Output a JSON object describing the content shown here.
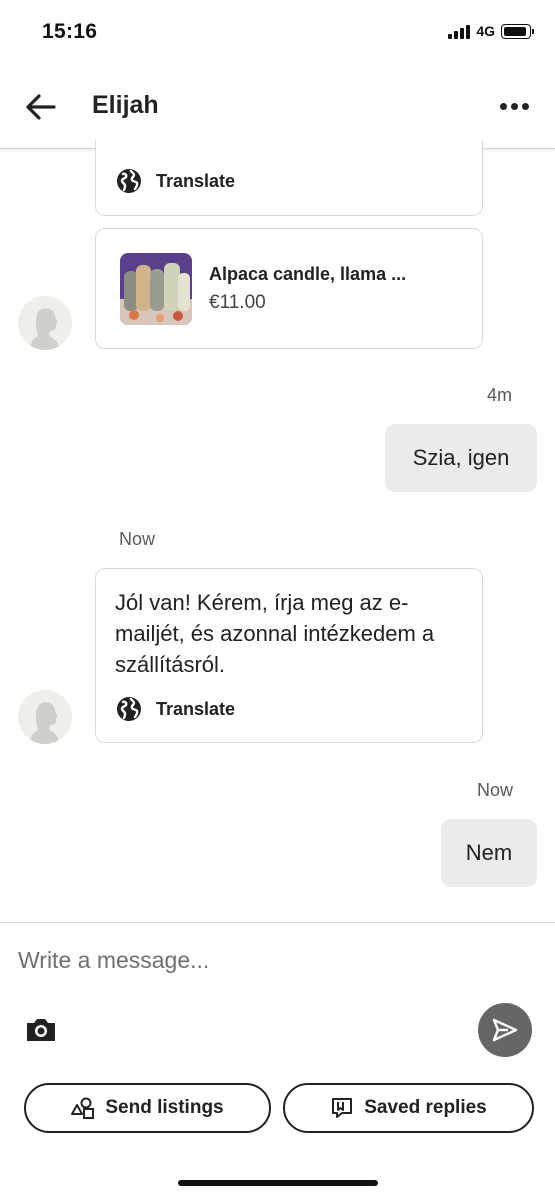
{
  "status_bar": {
    "time": "15:16",
    "network": "4G"
  },
  "header": {
    "title": "Elijah",
    "back_icon": "arrow-left-icon",
    "more_icon": "more-horizontal-icon"
  },
  "messages": {
    "first_bubble": {
      "translate_label": "Translate"
    },
    "listing": {
      "title": "Alpaca candle, llama ...",
      "price": "€11.00"
    },
    "outgoing_1": {
      "time": "4m",
      "text": "Szia, igen"
    },
    "incoming_2": {
      "time": "Now",
      "text": "Jól van! Kérem, írja meg az e-mailjét, és azonnal intézkedem a szállításról.",
      "translate_label": "Translate"
    },
    "outgoing_2": {
      "time": "Now",
      "text": "Nem"
    }
  },
  "composer": {
    "placeholder": "Write a message...",
    "value": "",
    "camera_icon": "camera-icon",
    "send_icon": "send-icon",
    "send_listings_label": "Send listings",
    "saved_replies_label": "Saved replies"
  },
  "colors": {
    "outgoing_bubble": "#ebebeb",
    "send_button": "#666666",
    "border": "#d9d9d9"
  }
}
